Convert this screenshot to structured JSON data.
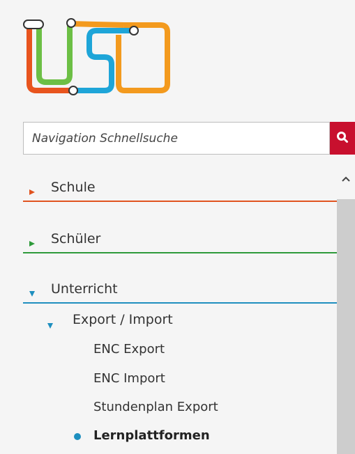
{
  "colors": {
    "schule": "#e0531f",
    "schueler": "#2e9a3a",
    "unterricht": "#1e8fbf",
    "search_button": "#c8102e",
    "logo_green": "#6cbf45",
    "logo_orange": "#f39a1e",
    "logo_blue": "#1ea5d8",
    "logo_red": "#e8541e"
  },
  "logo": {
    "icon": "usd-logo-icon"
  },
  "search": {
    "placeholder": "Navigation Schnellsuche",
    "value": "",
    "button_icon": "search-icon"
  },
  "scrollbar": {
    "up_icon": "chevron-up-icon"
  },
  "nav": {
    "sections": [
      {
        "label": "Schule",
        "expanded": false
      },
      {
        "label": "Schüler",
        "expanded": false
      },
      {
        "label": "Unterricht",
        "expanded": true
      }
    ],
    "unterricht": {
      "group_label": "Export / Import",
      "items": [
        {
          "label": "ENC Export"
        },
        {
          "label": "ENC Import"
        },
        {
          "label": "Stundenplan Export"
        },
        {
          "label": "Lernplattformen",
          "active": true
        }
      ]
    }
  }
}
